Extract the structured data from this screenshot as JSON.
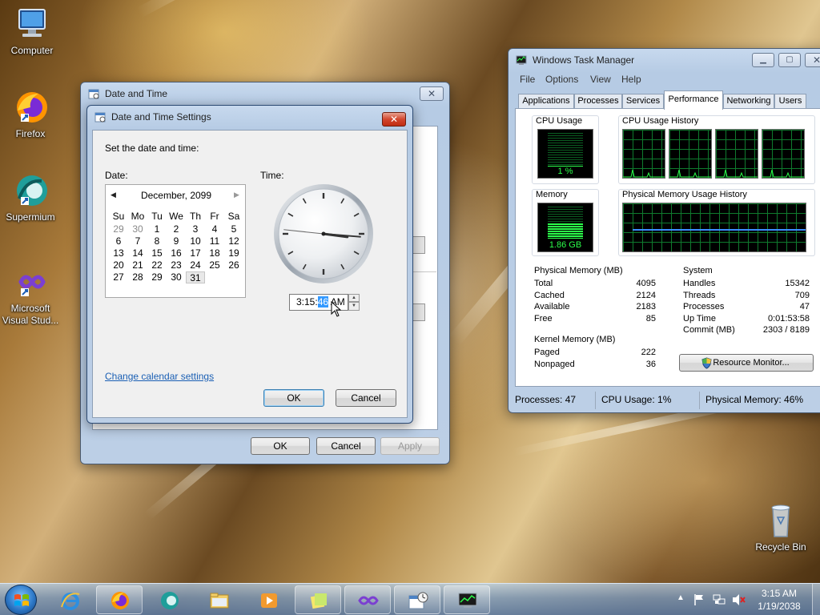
{
  "desktop": {
    "icons": [
      {
        "label": "Computer",
        "icon": "computer-icon"
      },
      {
        "label": "Firefox",
        "icon": "firefox-icon"
      },
      {
        "label": "Supermium",
        "icon": "supermium-icon"
      },
      {
        "label": "Microsoft Visual Stud...",
        "icon": "visual-studio-icon"
      },
      {
        "label": "Recycle Bin",
        "icon": "recycle-bin-icon"
      }
    ]
  },
  "date_time_dialog": {
    "title": "Date and Time",
    "close_label": "✕",
    "ok_label": "OK",
    "cancel_label": "Cancel",
    "apply_label": "Apply"
  },
  "settings_dialog": {
    "title": "Date and Time Settings",
    "close_label": "✕",
    "instruction": "Set the date and time:",
    "date_label": "Date:",
    "time_label": "Time:",
    "calendar": {
      "prev": "◀",
      "next": "▶",
      "month_year": "December, 2099",
      "weekdays": [
        "Su",
        "Mo",
        "Tu",
        "We",
        "Th",
        "Fr",
        "Sa"
      ],
      "weeks": [
        [
          "29",
          "30",
          "1",
          "2",
          "3",
          "4",
          "5"
        ],
        [
          "6",
          "7",
          "8",
          "9",
          "10",
          "11",
          "12"
        ],
        [
          "13",
          "14",
          "15",
          "16",
          "17",
          "18",
          "19"
        ],
        [
          "20",
          "21",
          "22",
          "23",
          "24",
          "25",
          "26"
        ],
        [
          "27",
          "28",
          "29",
          "30",
          "31",
          "",
          ""
        ]
      ],
      "selected_day": "31"
    },
    "clock": {
      "hour": 3,
      "minute": 15,
      "second": 46
    },
    "time_value": {
      "hm": "3:15:",
      "seconds": "46",
      "ampm": " AM"
    },
    "spin_up": "▲",
    "spin_down": "▼",
    "change_calendar_link": "Change calendar settings",
    "ok_label": "OK",
    "cancel_label": "Cancel"
  },
  "task_manager": {
    "title": "Windows Task Manager",
    "menu": [
      "File",
      "Options",
      "View",
      "Help"
    ],
    "tabs": [
      "Applications",
      "Processes",
      "Services",
      "Performance",
      "Networking",
      "Users"
    ],
    "active_tab": "Performance",
    "cpu_usage_label": "CPU Usage",
    "cpu_usage_value": "1 %",
    "cpu_history_label": "CPU Usage History",
    "memory_label": "Memory",
    "memory_value": "1.86 GB",
    "memory_history_label": "Physical Memory Usage History",
    "physical_memory": {
      "title": "Physical Memory (MB)",
      "rows": [
        {
          "k": "Total",
          "v": "4095"
        },
        {
          "k": "Cached",
          "v": "2124"
        },
        {
          "k": "Available",
          "v": "2183"
        },
        {
          "k": "Free",
          "v": "85"
        }
      ]
    },
    "kernel_memory": {
      "title": "Kernel Memory (MB)",
      "rows": [
        {
          "k": "Paged",
          "v": "222"
        },
        {
          "k": "Nonpaged",
          "v": "36"
        }
      ]
    },
    "system": {
      "title": "System",
      "rows": [
        {
          "k": "Handles",
          "v": "15342"
        },
        {
          "k": "Threads",
          "v": "709"
        },
        {
          "k": "Processes",
          "v": "47"
        },
        {
          "k": "Up Time",
          "v": "0:01:53:58"
        },
        {
          "k": "Commit (MB)",
          "v": "2303 / 8189"
        }
      ]
    },
    "resource_monitor_label": "Resource Monitor...",
    "status": {
      "processes": "Processes: 47",
      "cpu": "CPU Usage: 1%",
      "memory": "Physical Memory: 46%"
    },
    "cpu_fraction": 0.01,
    "memory_fraction": 0.46
  },
  "taskbar": {
    "apps": [
      "internet-explorer-icon",
      "firefox-icon",
      "supermium-icon",
      "file-explorer-icon",
      "media-player-icon",
      "sticky-notes-icon",
      "visual-studio-icon",
      "date-time-icon",
      "task-manager-icon"
    ],
    "clock_time": "3:15 AM",
    "clock_date": "1/19/2038"
  },
  "colors": {
    "accent": "#3c7fb1",
    "graph_green": "#2bff4a",
    "link": "#1a5fb4"
  }
}
